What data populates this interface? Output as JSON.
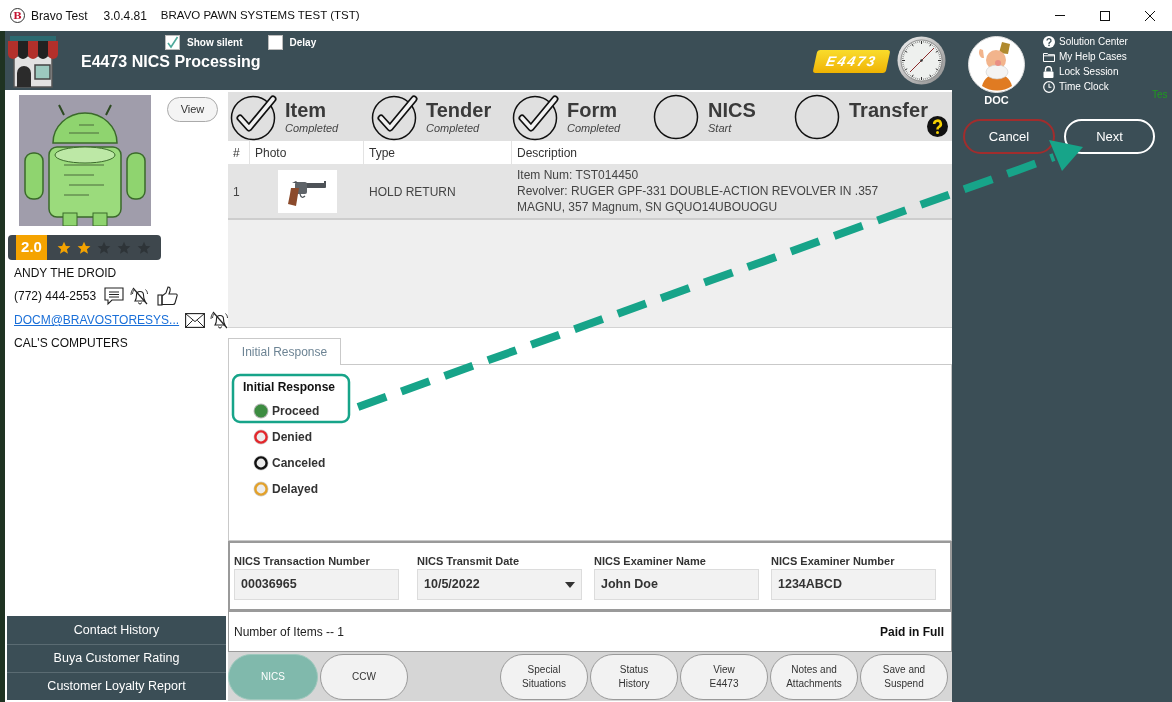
{
  "title_bar": {
    "logo_letter": "B",
    "app_name": "Bravo Test",
    "version": "3.0.4.81",
    "environment": "BRAVO PAWN SYSTEMS TEST (TST)"
  },
  "header": {
    "title": "E4473 NICS Processing",
    "options": [
      {
        "label": "Show silent",
        "checked": true
      },
      {
        "label": "Delay",
        "checked": false
      }
    ],
    "badge": "E4473"
  },
  "user": {
    "name": "DOC",
    "links": [
      {
        "label": "Solution Center",
        "kind": "help"
      },
      {
        "label": "My Help Cases",
        "kind": "folder"
      },
      {
        "label": "Lock Session",
        "kind": "lock"
      },
      {
        "label": "Time Clock",
        "kind": "clock"
      }
    ],
    "edge_label": "Tes",
    "actions": [
      {
        "label": "Cancel",
        "kind": "cancel"
      },
      {
        "label": "Next",
        "kind": "next"
      }
    ]
  },
  "customer": {
    "view_button": "View",
    "rating": "2.0",
    "stars": 2,
    "name": "ANDY THE DROID",
    "phone": "(772) 444-2553",
    "email": "DOCM@BRAVOSTORESYS...",
    "company": "CAL'S COMPUTERS",
    "reports": [
      "Contact History",
      "Buya Customer Rating",
      "Customer Loyalty Report"
    ]
  },
  "steps": [
    {
      "label": "Item",
      "status": "Completed",
      "done": true
    },
    {
      "label": "Tender",
      "status": "Completed",
      "done": true
    },
    {
      "label": "Form",
      "status": "Completed",
      "done": true
    },
    {
      "label": "NICS",
      "status": "Start",
      "done": false
    },
    {
      "label": "Transfer",
      "done": false
    }
  ],
  "items_table": {
    "columns": [
      "#",
      "Photo",
      "Type",
      "Description"
    ],
    "rows": [
      {
        "number": "1",
        "type": "HOLD RETURN",
        "description": [
          "Item Num: TST014450",
          "Revolver: RUGER GPF-331 DOUBLE-ACTION REVOLVER IN .357 MAGNU, 357 Magnum, SN GQUO14UBOUOGU"
        ]
      }
    ]
  },
  "response": {
    "tabs": [
      {
        "label": "Initial Response",
        "selected": true
      }
    ],
    "heading": "Initial Response",
    "options": [
      {
        "label": "Proceed",
        "selected": true,
        "color": "#3d8c41"
      },
      {
        "label": "Denied",
        "selected": false,
        "color": "#e3262b"
      },
      {
        "label": "Canceled",
        "selected": false,
        "color": "#111111"
      },
      {
        "label": "Delayed",
        "selected": false,
        "color": "#e3a12a"
      }
    ]
  },
  "nics_fields": [
    {
      "label": "NICS Transaction Number",
      "value": "00036965",
      "kind": "text"
    },
    {
      "label": "NICS Transmit Date",
      "value": "10/5/2022",
      "kind": "dropdown"
    },
    {
      "label": "NICS Examiner Name",
      "value": "John Doe",
      "kind": "text"
    },
    {
      "label": "NICS Examiner Number",
      "value": "1234ABCD",
      "kind": "text"
    }
  ],
  "summary": {
    "item_count": "Number of Items -- 1",
    "payment_status": "Paid in Full"
  },
  "footer": {
    "tabs": [
      {
        "label": "NICS",
        "selected": true
      },
      {
        "label": "CCW",
        "selected": false
      }
    ],
    "actions": [
      "Special\nSituations",
      "Status\nHistory",
      "View\nE4473",
      "Notes and\nAttachments",
      "Save and\nSuspend"
    ]
  }
}
